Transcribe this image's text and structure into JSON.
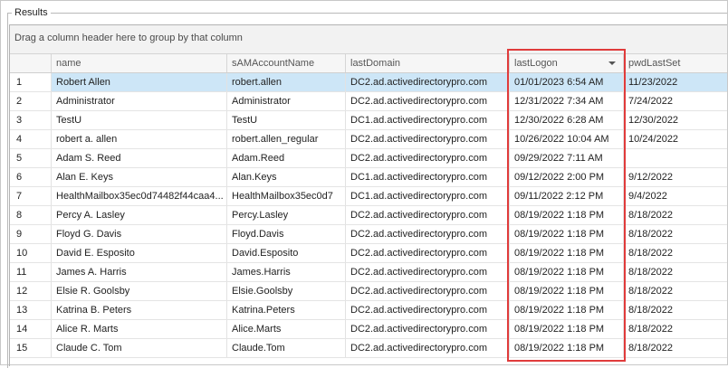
{
  "groupbox": {
    "title": "Results"
  },
  "grid": {
    "group_panel_text": "Drag a column header here to group by that column",
    "columns": [
      {
        "key": "name",
        "label": "name"
      },
      {
        "key": "sAMAccountName",
        "label": "sAMAccountName"
      },
      {
        "key": "lastDomain",
        "label": "lastDomain"
      },
      {
        "key": "lastLogon",
        "label": "lastLogon",
        "sorted": "descending"
      },
      {
        "key": "pwdLastSet",
        "label": "pwdLastSet"
      }
    ],
    "rows": [
      {
        "num": "1",
        "name": "Robert Allen",
        "sam": "robert.allen",
        "domain": "DC2.ad.activedirectorypro.com",
        "logon": "01/01/2023 6:54 AM",
        "pwd": "11/23/2022",
        "selected": true
      },
      {
        "num": "2",
        "name": "Administrator",
        "sam": "Administrator",
        "domain": "DC2.ad.activedirectorypro.com",
        "logon": "12/31/2022 7:34 AM",
        "pwd": "7/24/2022"
      },
      {
        "num": "3",
        "name": "TestU",
        "sam": "TestU",
        "domain": "DC1.ad.activedirectorypro.com",
        "logon": "12/30/2022 6:28 AM",
        "pwd": "12/30/2022"
      },
      {
        "num": "4",
        "name": "robert a. allen",
        "sam": "robert.allen_regular",
        "domain": "DC2.ad.activedirectorypro.com",
        "logon": "10/26/2022 10:04 AM",
        "pwd": "10/24/2022"
      },
      {
        "num": "5",
        "name": "Adam S. Reed",
        "sam": "Adam.Reed",
        "domain": "DC2.ad.activedirectorypro.com",
        "logon": "09/29/2022 7:11 AM",
        "pwd": ""
      },
      {
        "num": "6",
        "name": "Alan E. Keys",
        "sam": "Alan.Keys",
        "domain": "DC1.ad.activedirectorypro.com",
        "logon": "09/12/2022 2:00 PM",
        "pwd": "9/12/2022"
      },
      {
        "num": "7",
        "name": "HealthMailbox35ec0d74482f44caa4...",
        "sam": "HealthMailbox35ec0d7",
        "domain": "DC1.ad.activedirectorypro.com",
        "logon": "09/11/2022 2:12 PM",
        "pwd": "9/4/2022"
      },
      {
        "num": "8",
        "name": "Percy A. Lasley",
        "sam": "Percy.Lasley",
        "domain": "DC2.ad.activedirectorypro.com",
        "logon": "08/19/2022 1:18 PM",
        "pwd": "8/18/2022"
      },
      {
        "num": "9",
        "name": "Floyd G. Davis",
        "sam": "Floyd.Davis",
        "domain": "DC2.ad.activedirectorypro.com",
        "logon": "08/19/2022 1:18 PM",
        "pwd": "8/18/2022"
      },
      {
        "num": "10",
        "name": "David E. Esposito",
        "sam": "David.Esposito",
        "domain": "DC2.ad.activedirectorypro.com",
        "logon": "08/19/2022 1:18 PM",
        "pwd": "8/18/2022"
      },
      {
        "num": "11",
        "name": "James A. Harris",
        "sam": "James.Harris",
        "domain": "DC2.ad.activedirectorypro.com",
        "logon": "08/19/2022 1:18 PM",
        "pwd": "8/18/2022"
      },
      {
        "num": "12",
        "name": "Elsie R. Goolsby",
        "sam": "Elsie.Goolsby",
        "domain": "DC2.ad.activedirectorypro.com",
        "logon": "08/19/2022 1:18 PM",
        "pwd": "8/18/2022"
      },
      {
        "num": "13",
        "name": "Katrina B. Peters",
        "sam": "Katrina.Peters",
        "domain": "DC2.ad.activedirectorypro.com",
        "logon": "08/19/2022 1:18 PM",
        "pwd": "8/18/2022"
      },
      {
        "num": "14",
        "name": "Alice R. Marts",
        "sam": "Alice.Marts",
        "domain": "DC2.ad.activedirectorypro.com",
        "logon": "08/19/2022 1:18 PM",
        "pwd": "8/18/2022"
      },
      {
        "num": "15",
        "name": "Claude C. Tom",
        "sam": "Claude.Tom",
        "domain": "DC2.ad.activedirectorypro.com",
        "logon": "08/19/2022 1:18 PM",
        "pwd": "8/18/2022"
      }
    ]
  },
  "colors": {
    "selected_row": "#cde6f7",
    "highlight_border": "#e03b3b"
  }
}
